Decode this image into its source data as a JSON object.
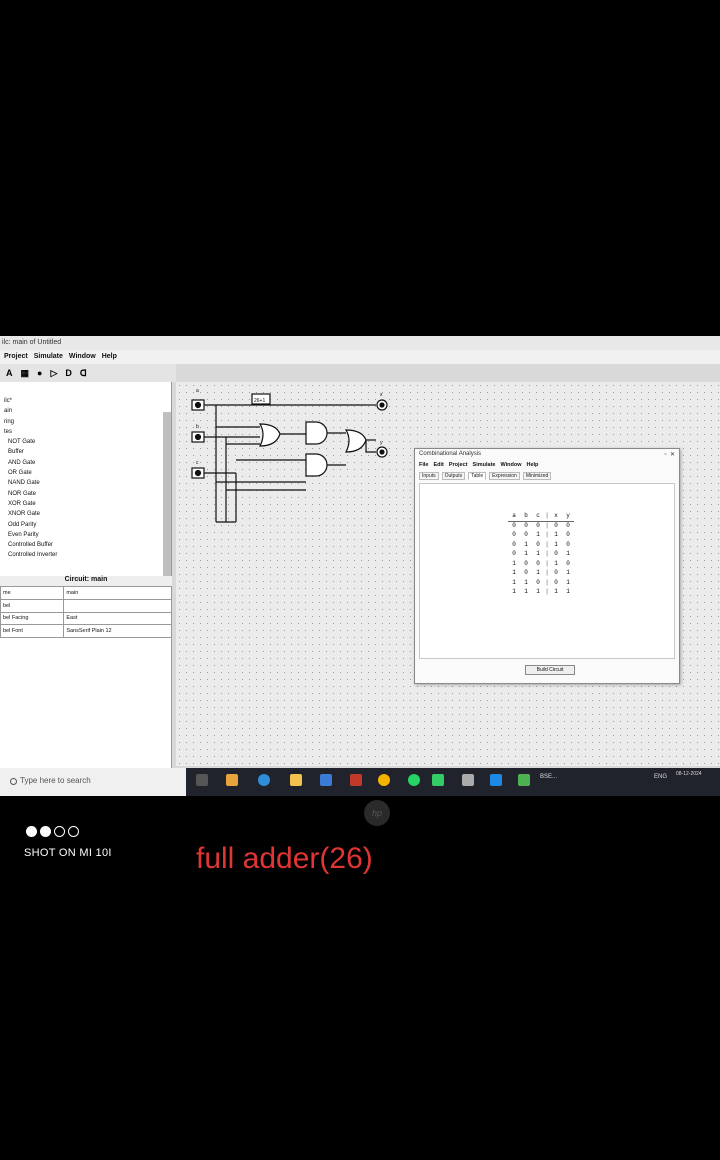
{
  "window": {
    "title": "ilc: main of Untitled"
  },
  "menu": [
    "Project",
    "Simulate",
    "Window",
    "Help"
  ],
  "toolbar": {
    "tool_text": "A"
  },
  "explorer": {
    "items": [
      "ilc*",
      "ain",
      "ring",
      "tes",
      "NOT Gate",
      "Buffer",
      "AND Gate",
      "OR Gate",
      "NAND Gate",
      "NOR Gate",
      "XOR Gate",
      "XNOR Gate",
      "Odd Parity",
      "Even Parity",
      "Controlled Buffer",
      "Controlled Inverter"
    ]
  },
  "attributes": {
    "title": "Circuit: main",
    "rows": [
      {
        "name": "me",
        "value": "main"
      },
      {
        "name": "bel",
        "value": ""
      },
      {
        "name": "bel Facing",
        "value": "East"
      },
      {
        "name": "bel Font",
        "value": "SansSerif Plain 12"
      }
    ]
  },
  "circuit": {
    "inputs": [
      "a",
      "b",
      "c"
    ],
    "outputs": [
      "x",
      "y"
    ],
    "label_box": "26+1"
  },
  "analysis": {
    "title": "Combinational Analysis",
    "menu": [
      "File",
      "Edit",
      "Project",
      "Simulate",
      "Window",
      "Help"
    ],
    "tabs": [
      "Inputs",
      "Outputs",
      "Table",
      "Expression",
      "Minimized"
    ],
    "active_tab": "Table",
    "columns": [
      "a",
      "b",
      "c",
      "x",
      "y"
    ],
    "rows": [
      [
        "0",
        "0",
        "0",
        "0",
        "0"
      ],
      [
        "0",
        "0",
        "1",
        "1",
        "0"
      ],
      [
        "0",
        "1",
        "0",
        "1",
        "0"
      ],
      [
        "0",
        "1",
        "1",
        "0",
        "1"
      ],
      [
        "1",
        "0",
        "0",
        "1",
        "0"
      ],
      [
        "1",
        "0",
        "1",
        "0",
        "1"
      ],
      [
        "1",
        "1",
        "0",
        "0",
        "1"
      ],
      [
        "1",
        "1",
        "1",
        "1",
        "1"
      ]
    ],
    "build_button": "Build Circuit"
  },
  "taskbar": {
    "search_placeholder": "Type here to search",
    "tray_text": "BSE...",
    "lang": "ENG",
    "time": "11:17",
    "date": "08-12-2024"
  },
  "camera": {
    "watermark": "SHOT ON MI 10I"
  },
  "caption": "full adder(26)"
}
